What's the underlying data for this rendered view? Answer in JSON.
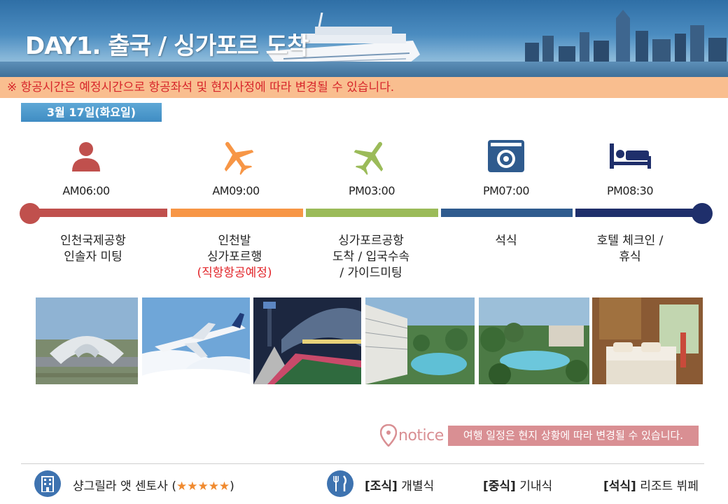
{
  "header": {
    "title": "DAY1. 출국 / 싱가포르 도착"
  },
  "warning": "※ 항공시간은 예정시간으로 항공좌석 및 현지사정에 따라 변경될 수 있습니다.",
  "date": "3월 17일(화요일)",
  "timeline": [
    {
      "time": "AM06:00",
      "icon": "person-icon",
      "color": "#c0504d",
      "lines": [
        "인천국제공항",
        "인솔자 미팅"
      ]
    },
    {
      "time": "AM09:00",
      "icon": "airplane-icon",
      "color": "#f79646",
      "lines": [
        "인천발",
        "싱가포르행"
      ],
      "note": "(직항항공예정)"
    },
    {
      "time": "PM03:00",
      "icon": "airplane-landing-icon",
      "color": "#9bbb59",
      "lines": [
        "싱가포르공항",
        "도착  / 입국수속",
        "/ 가이드미팅"
      ]
    },
    {
      "time": "PM07:00",
      "icon": "camera-icon",
      "color": "#2f5b8e",
      "lines": [
        "석식"
      ]
    },
    {
      "time": "PM08:30",
      "icon": "bed-icon",
      "color": "#1f2f6b",
      "lines": [
        "호텔 체크인 /",
        "휴식"
      ]
    }
  ],
  "photos": [
    "airport-photo",
    "airplane-photo",
    "changi-photo",
    "resort-pool-photo",
    "resort-garden-photo",
    "hotel-room-photo"
  ],
  "notice": {
    "label": "notice",
    "message": "여행 일정은 현지 상황에 따라 변경될 수 있습니다."
  },
  "footer": {
    "hotel_name": "샹그릴라 앳 센토사 (",
    "hotel_stars": "★★★★★",
    "hotel_close": ")",
    "breakfast_label": "[조식]",
    "breakfast_value": " 개별식",
    "lunch_label": "[중식]",
    "lunch_value": " 기내식",
    "dinner_label": "[석식]",
    "dinner_value": " 리조트 뷔페"
  },
  "colors": {
    "accent_red": "#c0504d",
    "accent_orange": "#f79646",
    "accent_green": "#9bbb59",
    "accent_blue": "#2f5b8e",
    "accent_navy": "#1f2f6b",
    "warning_bg": "#f9be8f",
    "notice": "#d98f93"
  }
}
